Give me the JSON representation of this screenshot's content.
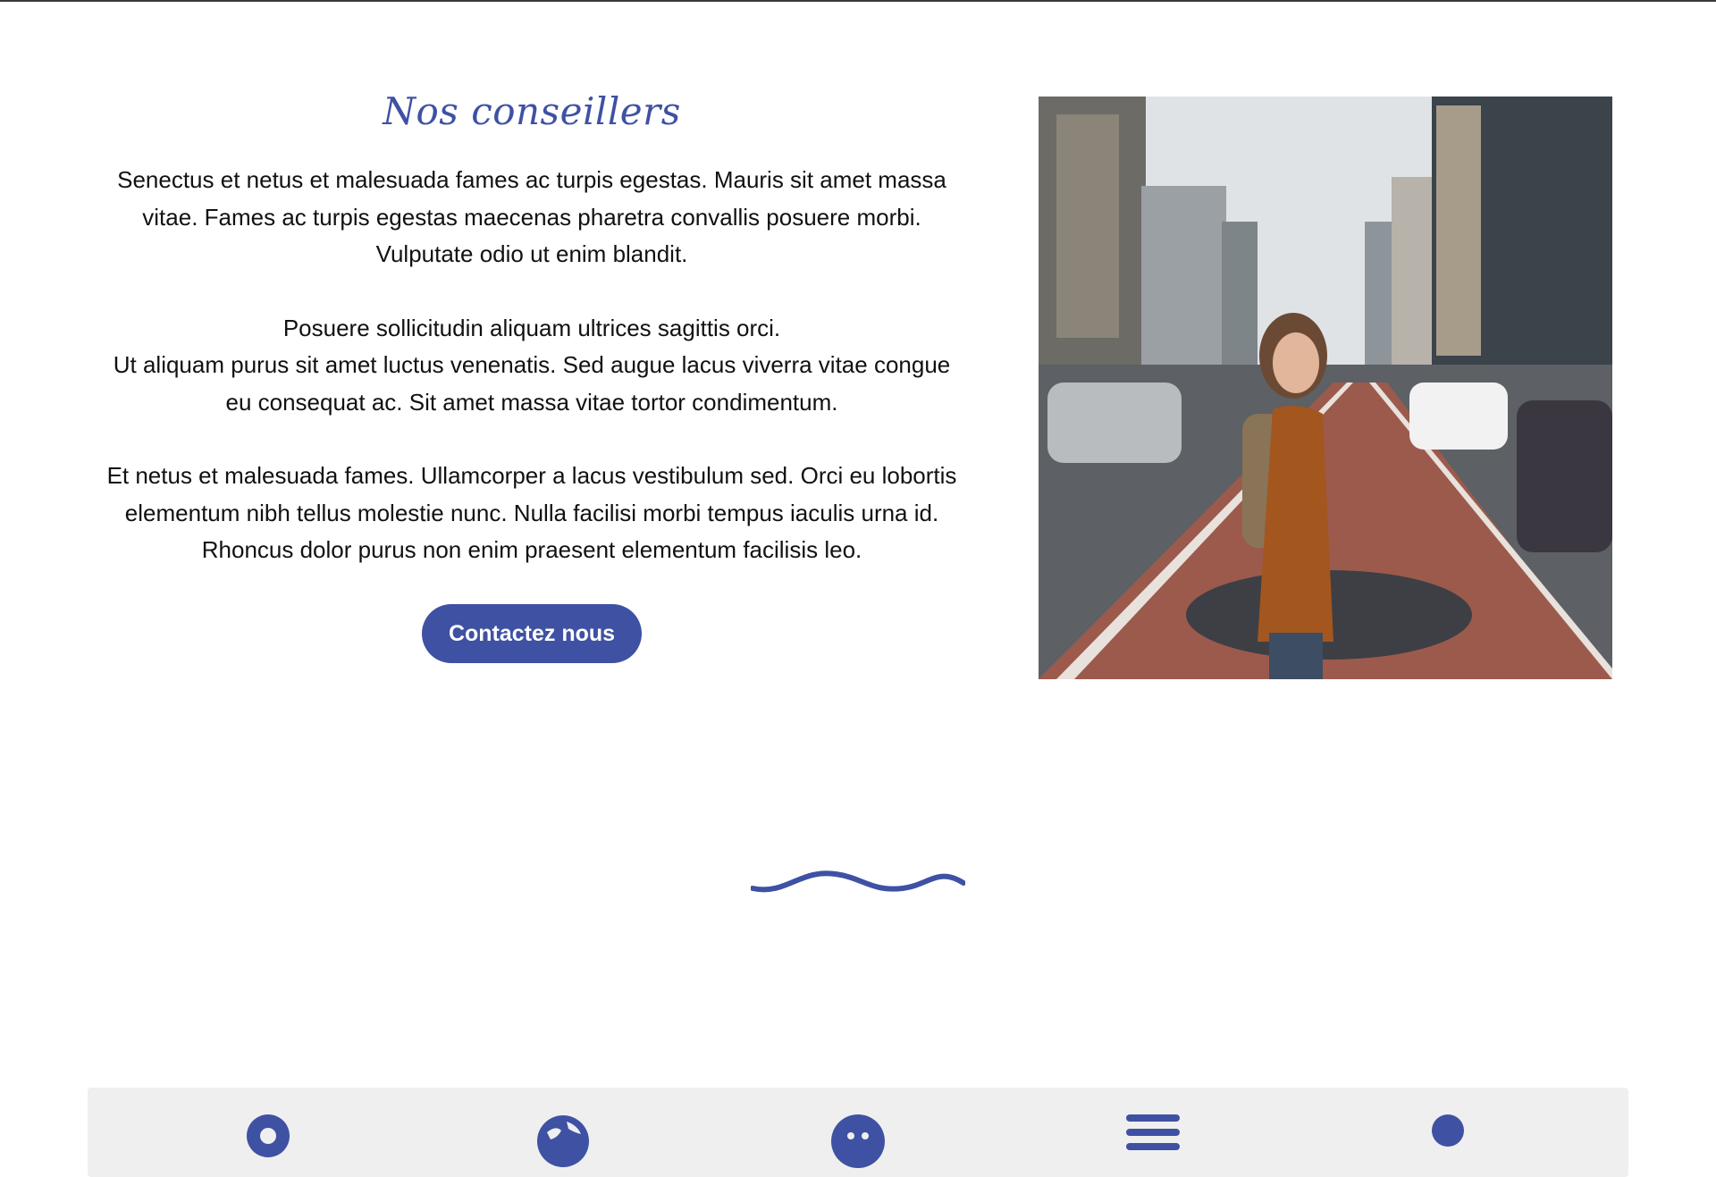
{
  "section": {
    "title": "Nos conseillers",
    "paragraphs": [
      "Senectus et netus et malesuada fames ac turpis egestas. Mauris sit amet massa vitae. Fames ac turpis egestas maecenas pharetra convallis posuere morbi. Vulputate odio ut enim blandit.",
      "Posuere sollicitudin aliquam ultrices sagittis orci.\nUt aliquam purus sit amet luctus venenatis. Sed augue lacus viverra vitae congue eu consequat ac. Sit amet massa vitae tortor condimentum.",
      "Et netus et malesuada fames. Ullamcorper a lacus vestibulum sed. Orci eu lobortis elementum nibh tellus molestie nunc. Nulla facilisi morbi tempus iaculis urna id. Rhoncus dolor purus non enim praesent elementum facilisis leo."
    ],
    "cta_label": "Contactez nous"
  },
  "photo": {
    "alt": "woman-with-backpack-on-city-bike-lane"
  },
  "footer": {
    "icons": [
      "location-pin-icon",
      "globe-icon",
      "smiley-icon",
      "menu-icon",
      "person-icon"
    ]
  },
  "colors": {
    "accent": "#3f51a3",
    "text": "#111111",
    "footer_bg": "#efefef"
  }
}
